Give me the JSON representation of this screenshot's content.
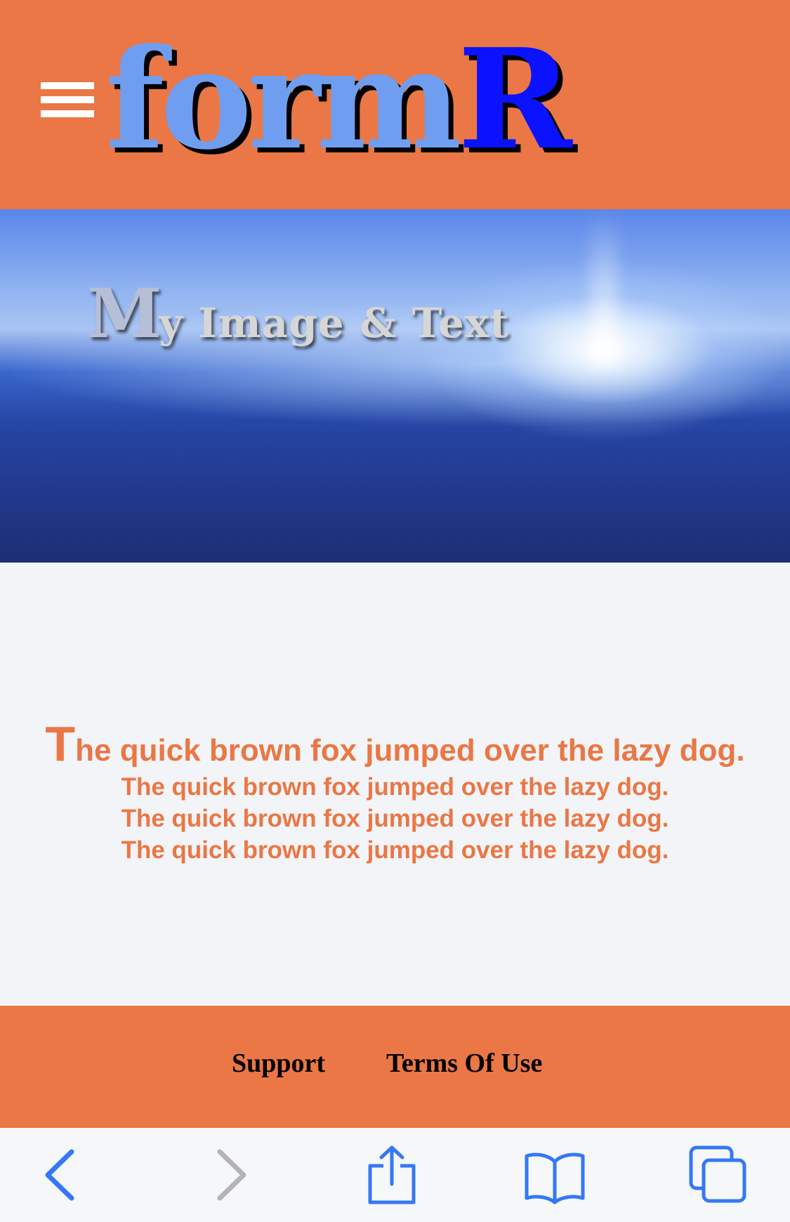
{
  "header": {
    "logo": {
      "part1": "form",
      "part2": "R"
    },
    "menu_icon": "hamburger-menu-icon"
  },
  "hero": {
    "title_cap": "M",
    "title_rest": "y Image & Text"
  },
  "content": {
    "first_line_cap": "T",
    "first_line_rest": "he quick brown fox jumped over the lazy dog.",
    "lines": [
      "The quick brown fox jumped over the lazy dog.",
      "The quick brown fox jumped over the lazy dog.",
      "The quick brown fox jumped over the lazy dog."
    ]
  },
  "footer": {
    "links": [
      "Support",
      "Terms Of Use"
    ]
  },
  "toolbar": {
    "icons": [
      "back-icon",
      "forward-icon",
      "share-icon",
      "bookmarks-icon",
      "tabs-icon"
    ]
  },
  "colors": {
    "brand_orange": "#ea7745",
    "logo_light_blue": "#6f9ef0",
    "logo_blue": "#0a12ff",
    "ios_blue": "#3478f6",
    "disabled_gray": "#b4b4b8"
  }
}
